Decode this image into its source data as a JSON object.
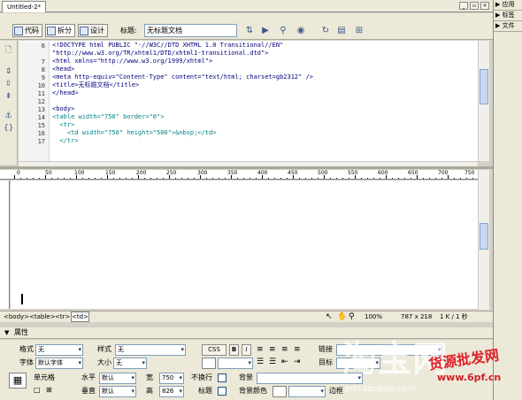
{
  "document": {
    "tab_title": "Untitled-2*"
  },
  "toolbar": {
    "code_label": "代码",
    "split_label": "拆分",
    "design_label": "设计",
    "title_label": "标题:",
    "title_value": "无标题文档"
  },
  "code": {
    "line_numbers": [
      "6",
      "7",
      "8",
      "9",
      "10",
      "11",
      "12",
      "13",
      "14",
      "15",
      "16",
      "17"
    ],
    "lines": [
      "<!DOCTYPE html PUBLIC \"-//W3C//DTD XHTML 1.0 Transitional//EN\"",
      "\"http://www.w3.org/TR/xhtml1/DTD/xhtml1-transitional.dtd\">",
      "<html xmlns=\"http://www.w3.org/1999/xhtml\">",
      "<head>",
      "<meta http-equiv=\"Content-Type\" content=\"text/html; charset=gb2312\" />",
      "<title>无标题文档</title>",
      "</head>",
      "",
      "<body>",
      "<table width=\"750\" border=\"0\">",
      "  <tr>",
      "    <td width=\"750\" height=\"500\">&nbsp;</td>",
      "  </tr>"
    ]
  },
  "ruler": {
    "labels": [
      "0",
      "50",
      "100",
      "150",
      "200",
      "250",
      "300",
      "350",
      "400",
      "450",
      "500",
      "550",
      "600",
      "650",
      "700",
      "750"
    ]
  },
  "statusbar": {
    "tags": [
      "<body>",
      "<table>",
      "<tr>",
      "<td>"
    ],
    "zoom": "100%",
    "dimensions": "787 x 218",
    "file_info": "1 K / 1 秒"
  },
  "properties": {
    "title": "属性",
    "format_label": "格式",
    "format_value": "无",
    "style_label": "样式",
    "style_value": "无",
    "css_button": "CSS",
    "bold_button": "B",
    "italic_button": "I",
    "link_label": "链接",
    "font_label": "字体",
    "font_value": "默认字体",
    "size_label": "大小",
    "size_value": "无",
    "target_label": "目标",
    "cell_label": "单元格",
    "horz_label": "水平",
    "horz_value": "默认",
    "vert_label": "垂直",
    "vert_value": "默认",
    "width_label": "宽",
    "width_value": "750",
    "height_label": "高",
    "height_value": "826",
    "nowrap_label": "不换行",
    "header_label": "标题",
    "bg_label": "背景",
    "bgcolor_label": "背景颜色",
    "border_label": "边框"
  },
  "panels": {
    "groups": [
      "应用",
      "标签",
      "文件"
    ]
  },
  "watermarks": {
    "left": "淘宝网",
    "url": "pds.taobao.com",
    "right": "货源批发网",
    "right_url": "www.6pf.cn"
  }
}
